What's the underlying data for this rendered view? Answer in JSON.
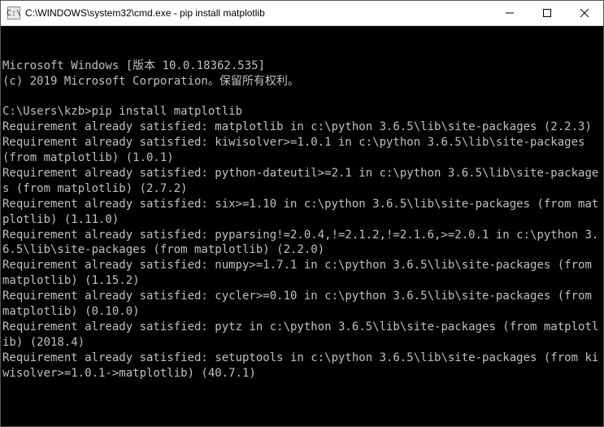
{
  "titlebar": {
    "icon_label": "C:\\",
    "title": "C:\\WINDOWS\\system32\\cmd.exe - pip  install matplotlib"
  },
  "terminal": {
    "lines": [
      "Microsoft Windows [版本 10.0.18362.535]",
      "(c) 2019 Microsoft Corporation。保留所有权利。",
      "",
      "C:\\Users\\kzb>pip install matplotlib",
      "Requirement already satisfied: matplotlib in c:\\python 3.6.5\\lib\\site-packages (2.2.3)",
      "Requirement already satisfied: kiwisolver>=1.0.1 in c:\\python 3.6.5\\lib\\site-packages (from matplotlib) (1.0.1)",
      "Requirement already satisfied: python-dateutil>=2.1 in c:\\python 3.6.5\\lib\\site-packages (from matplotlib) (2.7.2)",
      "Requirement already satisfied: six>=1.10 in c:\\python 3.6.5\\lib\\site-packages (from matplotlib) (1.11.0)",
      "Requirement already satisfied: pyparsing!=2.0.4,!=2.1.2,!=2.1.6,>=2.0.1 in c:\\python 3.6.5\\lib\\site-packages (from matplotlib) (2.2.0)",
      "Requirement already satisfied: numpy>=1.7.1 in c:\\python 3.6.5\\lib\\site-packages (from matplotlib) (1.15.2)",
      "Requirement already satisfied: cycler>=0.10 in c:\\python 3.6.5\\lib\\site-packages (from matplotlib) (0.10.0)",
      "Requirement already satisfied: pytz in c:\\python 3.6.5\\lib\\site-packages (from matplotlib) (2018.4)",
      "Requirement already satisfied: setuptools in c:\\python 3.6.5\\lib\\site-packages (from kiwisolver>=1.0.1->matplotlib) (40.7.1)",
      ""
    ]
  }
}
